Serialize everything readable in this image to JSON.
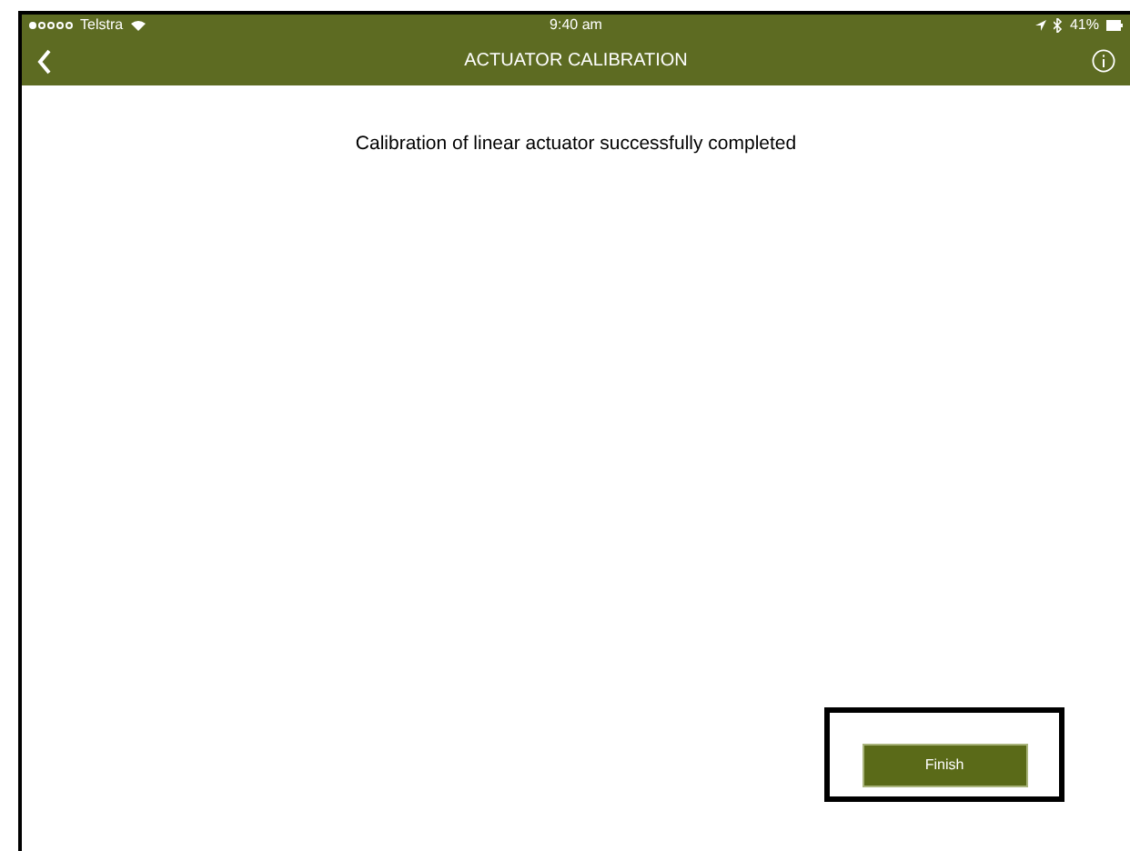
{
  "status_bar": {
    "carrier": "Telstra",
    "time": "9:40 am",
    "battery": "41%",
    "signal_dots": [
      true,
      false,
      false,
      false,
      false
    ]
  },
  "nav_bar": {
    "title": "ACTUATOR CALIBRATION"
  },
  "message": "Calibration of linear actuator successfully completed",
  "buttons": [
    {
      "label": "Finish",
      "highlighted": true
    }
  ]
}
